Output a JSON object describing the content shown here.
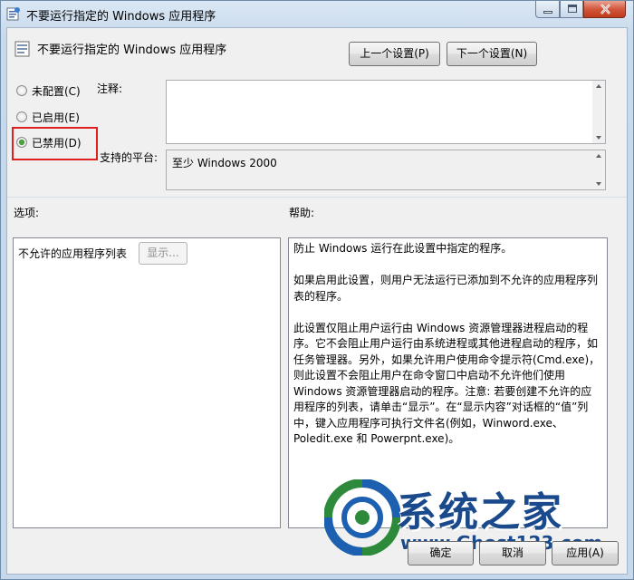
{
  "window": {
    "title": "不要运行指定的 Windows 应用程序"
  },
  "header": {
    "policy_name": "不要运行指定的 Windows 应用程序",
    "prev_button": "上一个设置(P)",
    "next_button": "下一个设置(N)"
  },
  "state": {
    "options": [
      {
        "label": "未配置(C)",
        "selected": false
      },
      {
        "label": "已启用(E)",
        "selected": false
      },
      {
        "label": "已禁用(D)",
        "selected": true
      }
    ],
    "highlight_color": "#e02020"
  },
  "comment": {
    "label": "注释:",
    "value": ""
  },
  "platform": {
    "label": "支持的平台:",
    "value": "至少 Windows 2000"
  },
  "options_section": {
    "label": "选项:",
    "list_label": "不允许的应用程序列表",
    "show_button": "显示..."
  },
  "help_section": {
    "label": "帮助:",
    "paragraphs": [
      "防止 Windows 运行在此设置中指定的程序。",
      "如果启用此设置，则用户无法运行已添加到不允许的应用程序列表的程序。",
      "此设置仅阻止用户运行由 Windows 资源管理器进程启动的程序。它不会阻止用户运行由系统进程或其他进程启动的程序，如任务管理器。另外，如果允许用户使用命令提示符(Cmd.exe)，则此设置不会阻止用户在命令窗口中启动不允许他们使用 Windows 资源管理器启动的程序。注意: 若要创建不允许的应用程序的列表，请单击“显示”。在“显示内容”对话框的“值”列中，键入应用程序可执行文件名(例如，Winword.exe、Poledit.exe 和 Powerpnt.exe)。"
    ]
  },
  "watermark": {
    "title": "系统之家",
    "url": "www.Ghost123.com"
  },
  "footer": {
    "ok": "确定",
    "cancel": "取消",
    "apply": "应用(A)"
  }
}
